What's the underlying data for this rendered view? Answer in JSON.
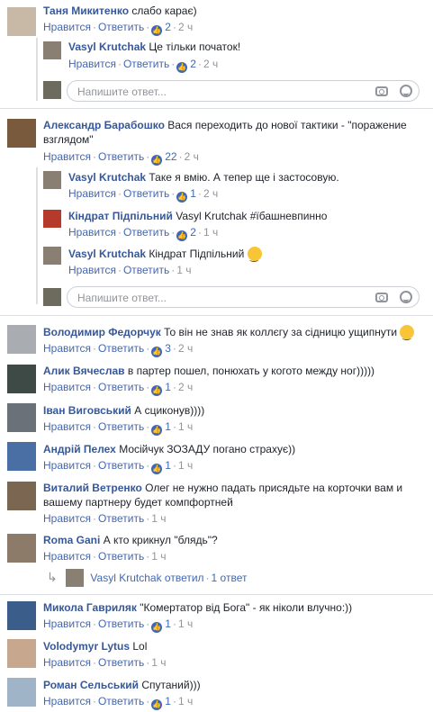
{
  "labels": {
    "like": "Нравится",
    "reply": "Ответить",
    "sep": "·",
    "placeholder": "Напишите ответ..."
  },
  "comments": [
    {
      "author": "Таня Микитенко",
      "text": "слабо карає)",
      "likes": "2",
      "time": "2 ч"
    },
    {
      "author": "Vasyl Krutchak",
      "text": "Це тільки початок!",
      "likes": "2",
      "time": "2 ч"
    },
    {
      "author": "Александр Барабошко",
      "text": "Вася переходить до нової тактики - \"поражение взглядом\"",
      "likes": "22",
      "time": "2 ч"
    },
    {
      "author": "Vasyl Krutchak",
      "text": "Таке я вмію. А тепер ще і застосовую.",
      "likes": "1",
      "time": "2 ч"
    },
    {
      "author": "Кіндрат Підпільний",
      "text": "Vasyl Krutchak #їбашневпинно",
      "likes": "2",
      "time": "1 ч"
    },
    {
      "author": "Vasyl Krutchak",
      "text": "Кіндрат Підпільний",
      "time": "1 ч"
    },
    {
      "author": "Володимир Федорчук",
      "text": "То він не знав як коллєгу за сідницю ущипнути",
      "likes": "3",
      "time": "2 ч"
    },
    {
      "author": "Алик Вячеслав",
      "text": "в партер пошел, понюхать у когото между ног)))))",
      "likes": "1",
      "time": "2 ч"
    },
    {
      "author": "Іван Виговський",
      "text": "А сциконув))))",
      "likes": "1",
      "time": "1 ч"
    },
    {
      "author": "Андрій Пелех",
      "text": "Мосійчук ЗОЗАДУ погано страхує))",
      "likes": "1",
      "time": "1 ч"
    },
    {
      "author": "Виталий Ветренко",
      "text": "Олег не нужно падать присядьте на корточки вам и вашему партнеру будет компфортней",
      "time": "1 ч"
    },
    {
      "author": "Roma Gani",
      "text": "А кто крикнул \"блядь\"?",
      "time": "1 ч"
    },
    {
      "author": "Микола Гавриляк",
      "text": "\"Комертатор від Бога\" - як ніколи влучно:))",
      "likes": "1",
      "time": "1 ч"
    },
    {
      "author": "Volodymyr Lytus",
      "text": "Lol",
      "time": "1 ч"
    },
    {
      "author": "Роман Сельський",
      "text": "Спутаний)))",
      "likes": "1",
      "time": "1 ч"
    }
  ],
  "replied": {
    "name": "Vasyl Krutchak",
    "verb": "ответил",
    "count": "1 ответ"
  },
  "colors": {
    "link": "#365899",
    "action": "#4267b2",
    "muted": "#90949c",
    "divider": "#dddfe2"
  }
}
